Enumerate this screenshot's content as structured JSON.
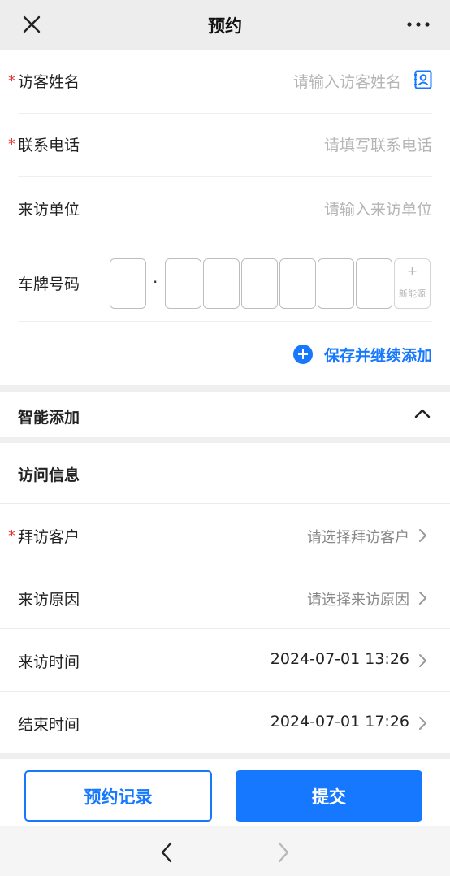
{
  "header": {
    "title": "预约",
    "close_icon": "close-icon",
    "more_icon": "more-icon"
  },
  "form": {
    "required_mark": "*",
    "visitor_name": {
      "label": "访客姓名",
      "placeholder": "请输入访客姓名",
      "required": true,
      "icon": "contact-card-icon"
    },
    "phone": {
      "label": "联系电话",
      "placeholder": "请填写联系电话",
      "required": true
    },
    "company": {
      "label": "来访单位",
      "placeholder": "请输入来访单位",
      "required": false
    },
    "plate": {
      "label": "车牌号码",
      "separator": "·",
      "new_energy_plus": "+",
      "new_energy_label": "新能源"
    },
    "save_continue": "保存并继续添加"
  },
  "smart_add": {
    "title": "智能添加",
    "expanded": true
  },
  "visit_info": {
    "title": "访问信息",
    "customer": {
      "label": "拜访客户",
      "placeholder": "请选择拜访客户",
      "required": true
    },
    "reason": {
      "label": "来访原因",
      "placeholder": "请选择来访原因"
    },
    "start_time": {
      "label": "来访时间",
      "value": "2024-07-01 13:26"
    },
    "end_time": {
      "label": "结束时间",
      "value": "2024-07-01 17:26"
    }
  },
  "actions": {
    "records": "预约记录",
    "submit": "提交"
  },
  "colors": {
    "accent": "#1677ff",
    "required": "#e53935",
    "placeholder": "#b5b5b5"
  }
}
